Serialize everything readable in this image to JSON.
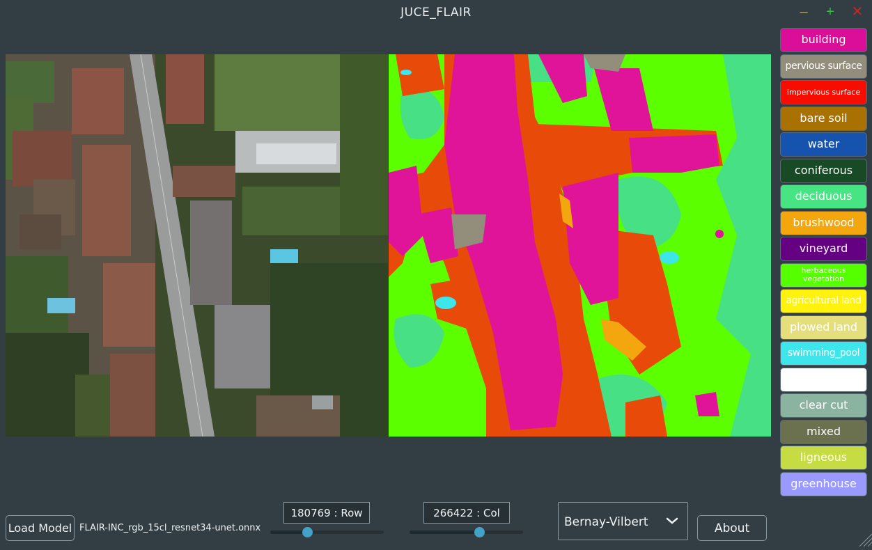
{
  "window": {
    "title": "JUCE_FLAIR",
    "minimize_icon": "minimize-icon",
    "maximize_icon": "maximize-icon",
    "close_icon": "close-icon"
  },
  "legend": {
    "items": [
      {
        "label": "building",
        "color": "#db0e9a",
        "text_color": "#ffffff"
      },
      {
        "label": "pervious surface",
        "color": "#938e7b",
        "text_color": "#ffffff"
      },
      {
        "label": "impervious surface",
        "color": "#f80c00",
        "text_color": "#ffffff"
      },
      {
        "label": "bare soil",
        "color": "#a97101",
        "text_color": "#ffffff"
      },
      {
        "label": "water",
        "color": "#1553ae",
        "text_color": "#ffffff"
      },
      {
        "label": "coniferous",
        "color": "#194a26",
        "text_color": "#ffffff"
      },
      {
        "label": "deciduous",
        "color": "#46e483",
        "text_color": "#ffffff"
      },
      {
        "label": "brushwood",
        "color": "#f3a60d",
        "text_color": "#ffffff"
      },
      {
        "label": "vineyard",
        "color": "#660082",
        "text_color": "#ffffff"
      },
      {
        "label": "herbaceous vegetation",
        "color": "#55ff00",
        "text_color": "#ffffff"
      },
      {
        "label": "agricultural land",
        "color": "#fff30d",
        "text_color": "#ffffff"
      },
      {
        "label": "plowed land",
        "color": "#e4df7c",
        "text_color": "#ffffff"
      },
      {
        "label": "swimming_pool",
        "color": "#3de6eb",
        "text_color": "#ffffff"
      },
      {
        "label": "",
        "color": "#ffffff",
        "text_color": "#000000"
      },
      {
        "label": "clear cut",
        "color": "#8ab3a0",
        "text_color": "#ffffff"
      },
      {
        "label": "mixed",
        "color": "#6b714f",
        "text_color": "#ffffff"
      },
      {
        "label": "ligneous",
        "color": "#c5dc42",
        "text_color": "#ffffff"
      },
      {
        "label": "greenhouse",
        "color": "#9999ff",
        "text_color": "#ffffff"
      }
    ]
  },
  "controls": {
    "load_model_label": "Load Model",
    "model_name": "FLAIR-INC_rgb_15cl_resnet34-unet.onnx",
    "row_text": "180769 : Row",
    "col_text": "266422 : Col",
    "row_slider_fraction": 0.31,
    "col_slider_fraction": 0.63,
    "location_value": "Bernay-Vilbert",
    "about_label": "About"
  }
}
